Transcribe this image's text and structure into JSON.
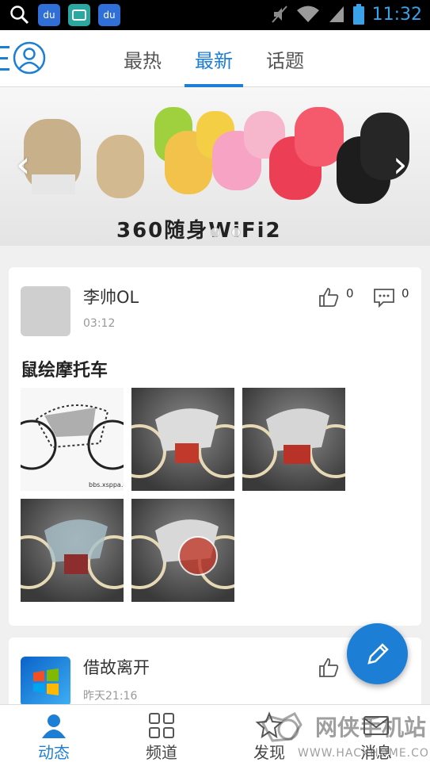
{
  "status_bar": {
    "time": "11:32",
    "baidu_label_1": "du",
    "baidu_label_2": "du"
  },
  "top_tabs": [
    {
      "label": "最热",
      "active": false
    },
    {
      "label": "最新",
      "active": true
    },
    {
      "label": "话题",
      "active": false
    }
  ],
  "banner": {
    "text": "360随身WiFi2",
    "slide_count": 2
  },
  "posts": [
    {
      "author": "李帅OL",
      "time": "03:12",
      "likes": "0",
      "comments": "0",
      "title": "鼠绘摩托车",
      "image_credit": "bbs.xsppa.cn",
      "image_count": 5
    },
    {
      "author": "借故离开",
      "time": "昨天21:16"
    }
  ],
  "bottom_nav": [
    {
      "label": "动态",
      "icon": "person-icon",
      "active": true
    },
    {
      "label": "频道",
      "icon": "grid-icon",
      "active": false
    },
    {
      "label": "发现",
      "icon": "star-icon",
      "active": false
    },
    {
      "label": "消息",
      "icon": "mail-icon",
      "active": false
    }
  ],
  "watermark": {
    "text": "网侠手机站",
    "url": "WWW.HACKHOME.COM"
  },
  "colors": {
    "accent": "#1d7ed6",
    "status_bar": "#000000",
    "background": "#f0f0f0"
  }
}
